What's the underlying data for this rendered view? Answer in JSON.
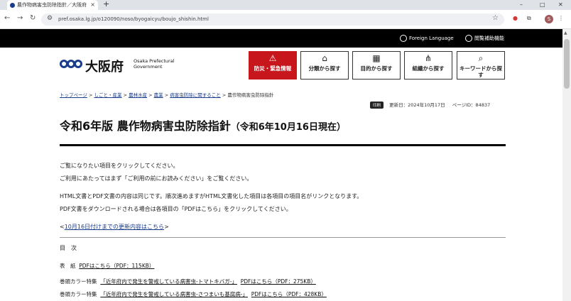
{
  "browser": {
    "tab_title": "農作物病害虫防除指針／大阪府",
    "tab_close": "×",
    "new_tab": "+",
    "url": "pref.osaka.lg.jp/o120090/noso/byogaicyu/boujo_shishin.html",
    "avatar_letter": "S",
    "win_min": "–",
    "win_max": "□",
    "win_close": "✕",
    "back": "←",
    "forward": "→",
    "reload": "↻"
  },
  "site": {
    "foreign_language": "Foreign Language",
    "accessibility": "閲覧補助機能",
    "logo_text": "大阪府",
    "logo_en_line1": "Osaka Prefectural",
    "logo_en_line2": "Government",
    "nav": [
      {
        "icon": "⚠",
        "label": "防災・緊急情報"
      },
      {
        "icon": "⌂",
        "label": "分類から探す"
      },
      {
        "icon": "▦",
        "label": "目的から探す"
      },
      {
        "icon": "⋔",
        "label": "組織から探す"
      },
      {
        "icon": "⌕",
        "label": "キーワードから探す"
      }
    ]
  },
  "breadcrumb": {
    "items": [
      "トップページ",
      "しごと・産業",
      "農林水産",
      "農業",
      "病害虫防除に関すること"
    ],
    "separator": " > ",
    "current": "農作物病害虫防除指針"
  },
  "meta": {
    "print_label": "印刷",
    "updated": "更新日：2024年10月17日",
    "page_id": "ページID：84837"
  },
  "page": {
    "title": "令和6年版 農作物病害虫防除指針",
    "title_sub": "（令和6年10月16日現在）",
    "intro1": "ご覧になりたい項目をクリックしてください。",
    "intro2": "ご利用にあたってはまず「ご利用の前にお読みください」をご覧ください。",
    "intro3": "HTML文書とPDF文書の内容は同じです。順次進めますがHTML文書化した項目は各項目の項目名がリンクとなります。",
    "intro4": "PDF文書をダウンロードされる場合は各項目の「PDFはこちら」をクリックしてください。",
    "update_prefix": "<",
    "update_link": "10月16日付けまでの更新内容はこちら",
    "update_suffix": ">",
    "toc_heading": "目　次",
    "items": [
      {
        "label": "表　紙",
        "desc": "",
        "pdf": "PDFはこちら（PDF：115KB）"
      },
      {
        "label": "巻頭カラー特集",
        "desc": "「近年府内で発生を警戒している病害虫-トマトキバガ-」",
        "pdf": "PDFはこちら（PDF：275KB）"
      },
      {
        "label": "巻頭カラー特集",
        "desc": "「近年府内で発生を警戒している病害虫-さつまいも基腐病-」",
        "pdf": "PDFはこちら（PDF：428KB）"
      }
    ]
  }
}
